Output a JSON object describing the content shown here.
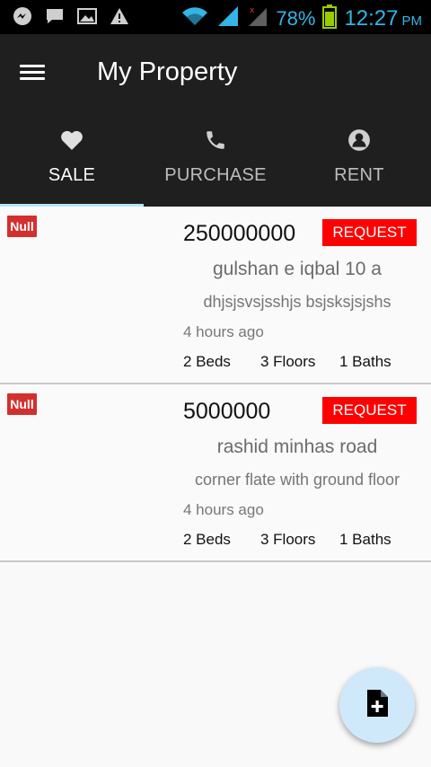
{
  "status_bar": {
    "battery_percent": "78%",
    "time": "12:27",
    "ampm": "PM",
    "icons": [
      "messenger-icon",
      "chat-icon",
      "gallery-icon",
      "warning-icon",
      "wifi-icon",
      "signal-icon",
      "signal-no-sim-icon",
      "battery-icon"
    ]
  },
  "appbar": {
    "title": "My Property",
    "menu_icon": "hamburger-menu-icon"
  },
  "tabs": [
    {
      "label": "SALE",
      "icon": "heart-icon",
      "active": true
    },
    {
      "label": "PURCHASE",
      "icon": "phone-icon",
      "active": false
    },
    {
      "label": "RENT",
      "icon": "person-circle-icon",
      "active": false
    }
  ],
  "listings": [
    {
      "badge": "Null",
      "price": "250000000",
      "request_label": "REQUEST",
      "location": "gulshan e iqbal 10 a",
      "description": "dhjsjsvsjsshjs bsjsksjsjshs",
      "time": "4 hours ago",
      "beds": "2 Beds",
      "floors": "3 Floors",
      "baths": "1 Baths"
    },
    {
      "badge": "Null",
      "price": "5000000",
      "request_label": "REQUEST",
      "location": "rashid minhas road",
      "description": "corner flate with ground floor",
      "time": "4 hours ago",
      "beds": "2 Beds",
      "floors": "3 Floors",
      "baths": "1 Baths"
    }
  ],
  "fab": {
    "icon": "add-document-icon"
  },
  "colors": {
    "appbar": "#1f1f1f",
    "status_accent": "#33b5e5",
    "request": "#ff0000",
    "badge": "#d32f2f",
    "tab_indicator": "#b3e5fc",
    "fab": "#cfe9fb"
  }
}
